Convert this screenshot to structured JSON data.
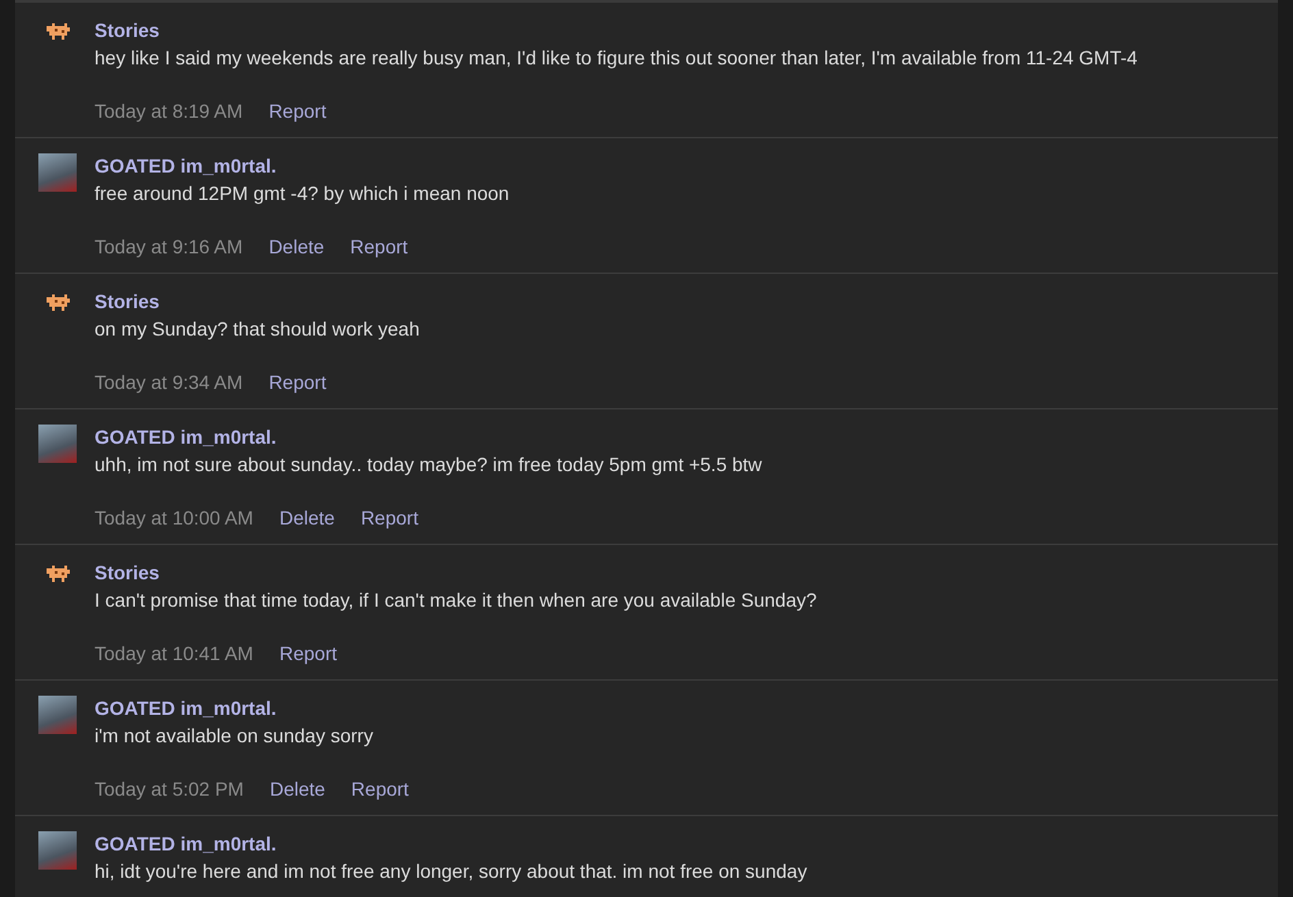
{
  "messages": [
    {
      "author": "Stories",
      "kind": "pixel",
      "text": "hey like I said my weekends are really busy man, I'd like to figure this out sooner than later, I'm available from 11-24 GMT-4",
      "time": "Today at 8:19 AM",
      "actions": [
        "Report"
      ]
    },
    {
      "author": "GOATED im_m0rtal.",
      "kind": "photo",
      "text": "free around 12PM gmt -4? by which i mean noon",
      "time": "Today at 9:16 AM",
      "actions": [
        "Delete",
        "Report"
      ]
    },
    {
      "author": "Stories",
      "kind": "pixel",
      "text": "on my Sunday? that should work yeah",
      "time": "Today at 9:34 AM",
      "actions": [
        "Report"
      ]
    },
    {
      "author": "GOATED im_m0rtal.",
      "kind": "photo",
      "text": "uhh, im not sure about sunday.. today maybe? im free today 5pm gmt +5.5 btw",
      "time": "Today at 10:00 AM",
      "actions": [
        "Delete",
        "Report"
      ]
    },
    {
      "author": "Stories",
      "kind": "pixel",
      "text": "I can't promise that time today, if I can't make it then when are you available Sunday?",
      "time": "Today at 10:41 AM",
      "actions": [
        "Report"
      ]
    },
    {
      "author": "GOATED im_m0rtal.",
      "kind": "photo",
      "text": "i'm not available on sunday sorry",
      "time": "Today at 5:02 PM",
      "actions": [
        "Delete",
        "Report"
      ]
    },
    {
      "author": "GOATED im_m0rtal.",
      "kind": "photo",
      "text": "hi, idt you're here and im not free any longer, sorry about that. im not free on sunday"
    }
  ]
}
